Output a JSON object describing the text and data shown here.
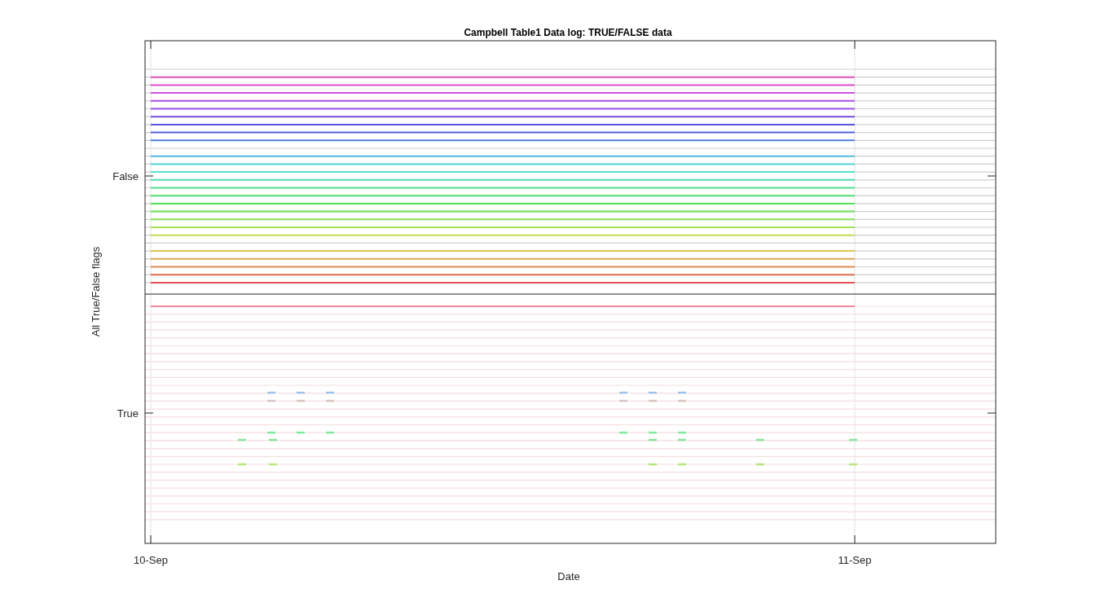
{
  "figure": {
    "title": "Campbell Table1 Data log: TRUE/FALSE data",
    "xlabel": "Date",
    "ylabel": "All True/False flags",
    "xtick_labels": [
      "10-Sep",
      "11-Sep"
    ],
    "ytick_labels": [
      "False",
      "True"
    ]
  }
}
